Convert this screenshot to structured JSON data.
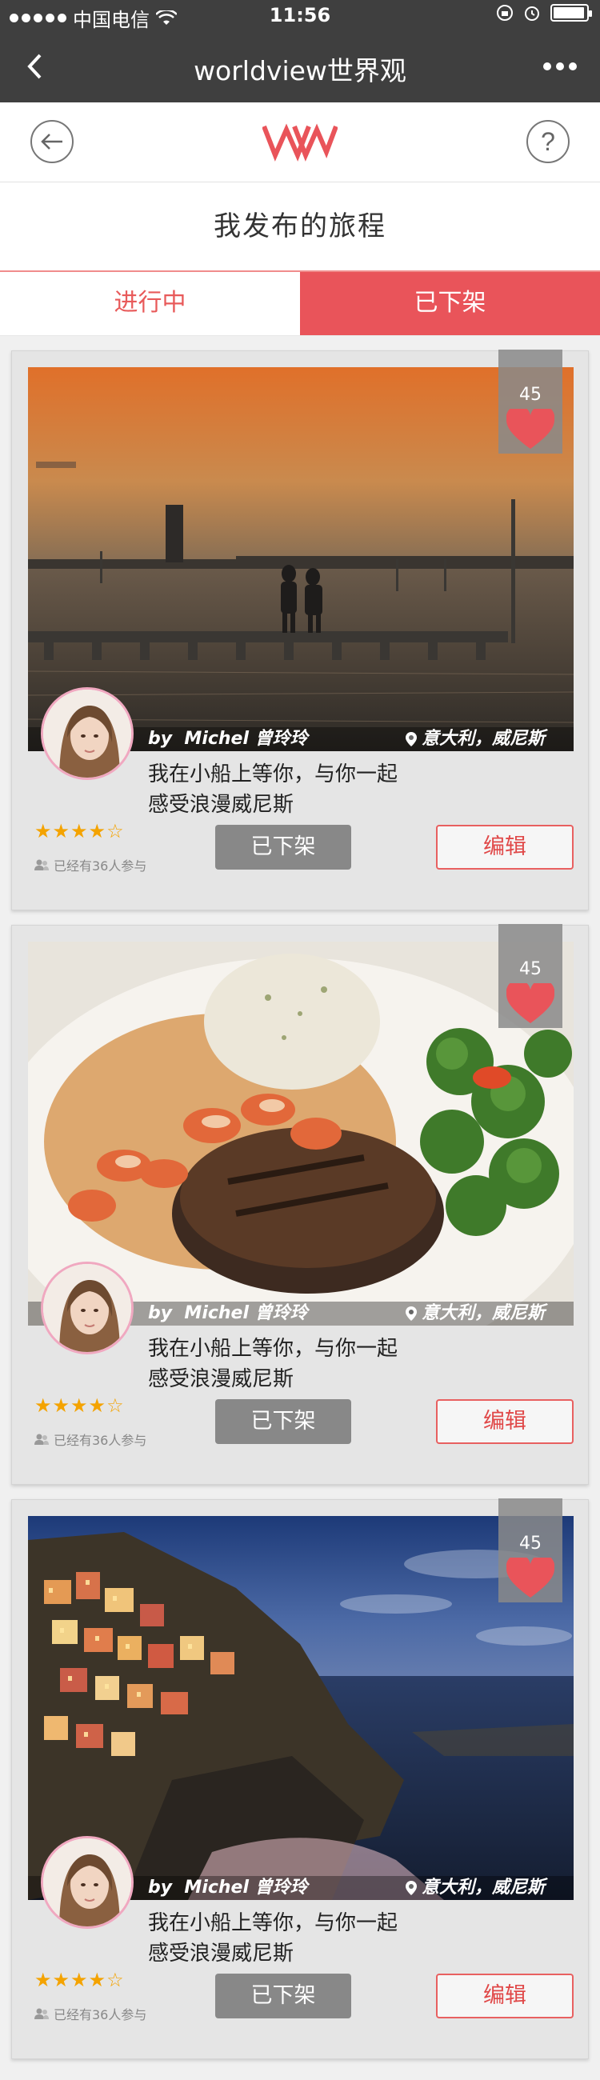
{
  "status_bar": {
    "carrier": "中国电信",
    "time": "11:56"
  },
  "nav": {
    "title": "worldview世界观"
  },
  "header": {
    "help_icon_label": "?"
  },
  "page": {
    "title": "我发布的旅程"
  },
  "tabs": [
    {
      "label": "进行中",
      "active": false
    },
    {
      "label": "已下架",
      "active": true
    }
  ],
  "cards": [
    {
      "scene": "sunset-pier",
      "likes": "45",
      "author_by": "by",
      "author_name": "Michel 曾玲玲",
      "location": "意大利，威尼斯",
      "desc_line1": "我在小船上等你，与你一起",
      "desc_line2": "感受浪漫威尼斯",
      "rating": 4,
      "stars_text": "★★★★☆",
      "participants": "已经有36人参与",
      "offline_label": "已下架",
      "edit_label": "编辑"
    },
    {
      "scene": "steak-shrimp",
      "likes": "45",
      "author_by": "by",
      "author_name": "Michel 曾玲玲",
      "location": "意大利，威尼斯",
      "desc_line1": "我在小船上等你，与你一起",
      "desc_line2": "感受浪漫威尼斯",
      "rating": 4,
      "stars_text": "★★★★☆",
      "participants": "已经有36人参与",
      "offline_label": "已下架",
      "edit_label": "编辑"
    },
    {
      "scene": "cliff-village",
      "likes": "45",
      "author_by": "by",
      "author_name": "Michel 曾玲玲",
      "location": "意大利，威尼斯",
      "desc_line1": "我在小船上等你，与你一起",
      "desc_line2": "感受浪漫威尼斯",
      "rating": 4,
      "stars_text": "★★★★☆",
      "participants": "已经有36人参与",
      "offline_label": "已下架",
      "edit_label": "编辑"
    }
  ],
  "colors": {
    "accent": "#e9545a",
    "nav_bg": "#3f3f3f",
    "star": "#f4a300"
  }
}
